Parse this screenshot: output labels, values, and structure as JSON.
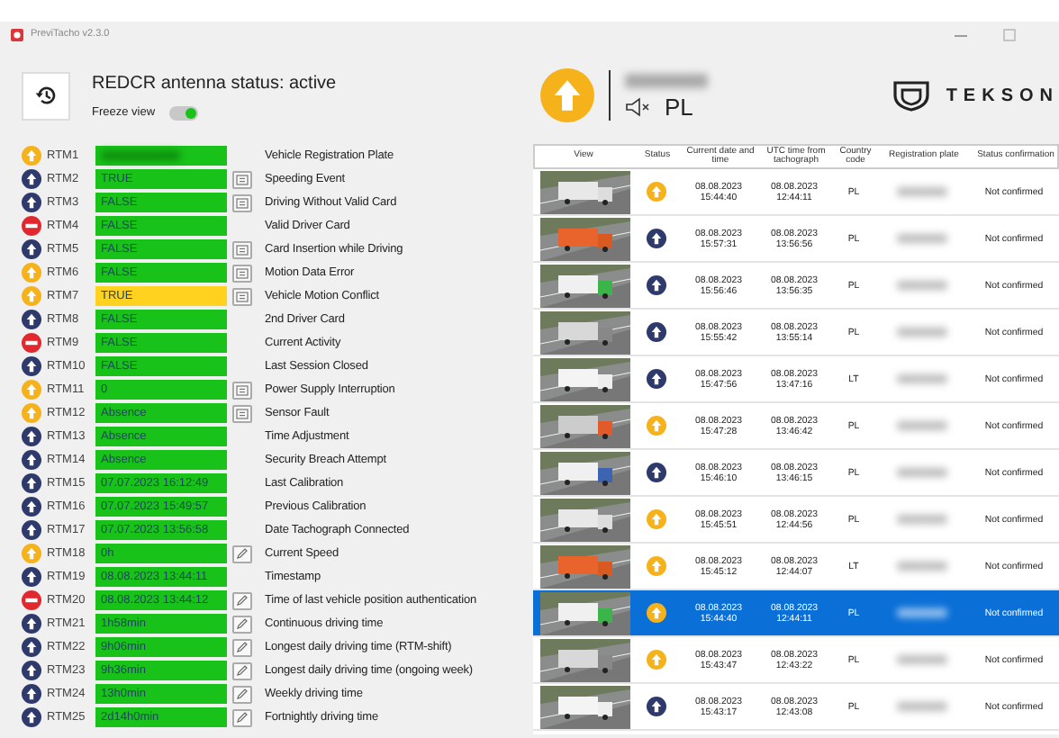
{
  "window": {
    "title": "PreviTacho v2.3.0"
  },
  "antenna": {
    "status_text": "REDCR antenna status: active",
    "freeze_view": {
      "label": "Freeze view",
      "on": true
    }
  },
  "vehicle": {
    "alert": {
      "kind": "warning"
    },
    "sound_muted": true,
    "country": "PL"
  },
  "logo": {
    "text": "TEKSON"
  },
  "rtm": [
    {
      "id": "RTM1",
      "status": {
        "kind": "warning"
      },
      "color": "#19c219",
      "label": "Vehicle Registration Plate"
    },
    {
      "id": "RTM2",
      "status": {
        "kind": "info"
      },
      "value": "TRUE",
      "color": "#19c219",
      "button": {
        "kind": "details"
      },
      "label": "Speeding Event"
    },
    {
      "id": "RTM3",
      "status": {
        "kind": "info"
      },
      "value": "FALSE",
      "color": "#19c219",
      "button": {
        "kind": "details"
      },
      "label": "Driving Without Valid Card"
    },
    {
      "id": "RTM4",
      "status": {
        "kind": "error"
      },
      "value": "FALSE",
      "color": "#19c219",
      "label": "Valid Driver Card"
    },
    {
      "id": "RTM5",
      "status": {
        "kind": "info"
      },
      "value": "FALSE",
      "color": "#19c219",
      "button": {
        "kind": "details"
      },
      "label": "Card Insertion while Driving"
    },
    {
      "id": "RTM6",
      "status": {
        "kind": "warning"
      },
      "value": "FALSE",
      "color": "#19c219",
      "button": {
        "kind": "details"
      },
      "label": "Motion Data Error"
    },
    {
      "id": "RTM7",
      "status": {
        "kind": "warning"
      },
      "value": "TRUE",
      "color": "#ffd21f",
      "button": {
        "kind": "details"
      },
      "label": "Vehicle Motion Conflict"
    },
    {
      "id": "RTM8",
      "status": {
        "kind": "info"
      },
      "value": "FALSE",
      "color": "#19c219",
      "label": "2nd Driver Card"
    },
    {
      "id": "RTM9",
      "status": {
        "kind": "error"
      },
      "value": "FALSE",
      "color": "#19c219",
      "label": "Current Activity"
    },
    {
      "id": "RTM10",
      "status": {
        "kind": "info"
      },
      "value": "FALSE",
      "color": "#19c219",
      "label": "Last Session Closed"
    },
    {
      "id": "RTM11",
      "status": {
        "kind": "warning"
      },
      "value": "0",
      "color": "#19c219",
      "button": {
        "kind": "details"
      },
      "label": "Power Supply Interruption"
    },
    {
      "id": "RTM12",
      "status": {
        "kind": "warning"
      },
      "value": "Absence",
      "color": "#19c219",
      "button": {
        "kind": "details"
      },
      "label": "Sensor Fault"
    },
    {
      "id": "RTM13",
      "status": {
        "kind": "info"
      },
      "value": "Absence",
      "color": "#19c219",
      "label": "Time Adjustment"
    },
    {
      "id": "RTM14",
      "status": {
        "kind": "info"
      },
      "value": "Absence",
      "color": "#19c219",
      "label": "Security Breach Attempt"
    },
    {
      "id": "RTM15",
      "status": {
        "kind": "info"
      },
      "value": "07.07.2023 16:12:49",
      "color": "#19c219",
      "label": "Last Calibration"
    },
    {
      "id": "RTM16",
      "status": {
        "kind": "info"
      },
      "value": "07.07.2023 15:49:57",
      "color": "#19c219",
      "label": "Previous Calibration"
    },
    {
      "id": "RTM17",
      "status": {
        "kind": "info"
      },
      "value": "07.07.2023 13:56:58",
      "color": "#19c219",
      "label": "Date Tachograph Connected"
    },
    {
      "id": "RTM18",
      "status": {
        "kind": "warning"
      },
      "value": "0h",
      "color": "#19c219",
      "button": {
        "kind": "edit"
      },
      "label": "Current Speed"
    },
    {
      "id": "RTM19",
      "status": {
        "kind": "info"
      },
      "value": "08.08.2023 13:44:11",
      "color": "#19c219",
      "label": "Timestamp"
    },
    {
      "id": "RTM20",
      "status": {
        "kind": "error"
      },
      "value": "08.08.2023 13:44:12",
      "color": "#19c219",
      "button": {
        "kind": "edit"
      },
      "label": "Time of last vehicle position authentication"
    },
    {
      "id": "RTM21",
      "status": {
        "kind": "info"
      },
      "value": "1h58min",
      "color": "#19c219",
      "button": {
        "kind": "edit"
      },
      "label": "Continuous driving time"
    },
    {
      "id": "RTM22",
      "status": {
        "kind": "info"
      },
      "value": "9h06min",
      "color": "#19c219",
      "button": {
        "kind": "edit"
      },
      "label": "Longest daily driving time (RTM-shift)"
    },
    {
      "id": "RTM23",
      "status": {
        "kind": "info"
      },
      "value": "9h36min",
      "color": "#19c219",
      "button": {
        "kind": "edit"
      },
      "label": "Longest daily driving time (ongoing week)"
    },
    {
      "id": "RTM24",
      "status": {
        "kind": "info"
      },
      "value": "13h0min",
      "color": "#19c219",
      "button": {
        "kind": "edit"
      },
      "label": "Weekly driving time"
    },
    {
      "id": "RTM25",
      "status": {
        "kind": "info"
      },
      "value": "2d14h0min",
      "color": "#19c219",
      "button": {
        "kind": "edit"
      },
      "label": "Fortnightly driving time"
    }
  ],
  "table": {
    "columns": [
      "View",
      "Status",
      "Current date and time",
      "UTC time from tachograph",
      "Country code",
      "Registration plate",
      "Status confirmation"
    ],
    "rows": [
      {
        "status": {
          "kind": "warning"
        },
        "date": "08.08.2023",
        "time": "15:44:40",
        "utc_date": "08.08.2023",
        "utc_time": "12:44:11",
        "country": "PL",
        "confirmation": "Not confirmed",
        "selected": false
      },
      {
        "status": {
          "kind": "info"
        },
        "date": "08.08.2023",
        "time": "15:57:31",
        "utc_date": "08.08.2023",
        "utc_time": "13:56:56",
        "country": "PL",
        "confirmation": "Not confirmed",
        "selected": false
      },
      {
        "status": {
          "kind": "info"
        },
        "date": "08.08.2023",
        "time": "15:56:46",
        "utc_date": "08.08.2023",
        "utc_time": "13:56:35",
        "country": "PL",
        "confirmation": "Not confirmed",
        "selected": false
      },
      {
        "status": {
          "kind": "info"
        },
        "date": "08.08.2023",
        "time": "15:55:42",
        "utc_date": "08.08.2023",
        "utc_time": "13:55:14",
        "country": "PL",
        "confirmation": "Not confirmed",
        "selected": false
      },
      {
        "status": {
          "kind": "info"
        },
        "date": "08.08.2023",
        "time": "15:47:56",
        "utc_date": "08.08.2023",
        "utc_time": "13:47:16",
        "country": "LT",
        "confirmation": "Not confirmed",
        "selected": false
      },
      {
        "status": {
          "kind": "warning"
        },
        "date": "08.08.2023",
        "time": "15:47:28",
        "utc_date": "08.08.2023",
        "utc_time": "13:46:42",
        "country": "PL",
        "confirmation": "Not confirmed",
        "selected": false
      },
      {
        "status": {
          "kind": "info"
        },
        "date": "08.08.2023",
        "time": "15:46:10",
        "utc_date": "08.08.2023",
        "utc_time": "13:46:15",
        "country": "PL",
        "confirmation": "Not confirmed",
        "selected": false
      },
      {
        "status": {
          "kind": "warning"
        },
        "date": "08.08.2023",
        "time": "15:45:51",
        "utc_date": "08.08.2023",
        "utc_time": "12:44:56",
        "country": "PL",
        "confirmation": "Not confirmed",
        "selected": false
      },
      {
        "status": {
          "kind": "warning"
        },
        "date": "08.08.2023",
        "time": "15:45:12",
        "utc_date": "08.08.2023",
        "utc_time": "12:44:07",
        "country": "LT",
        "confirmation": "Not confirmed",
        "selected": false
      },
      {
        "status": {
          "kind": "warning"
        },
        "date": "08.08.2023",
        "time": "15:44:40",
        "utc_date": "08.08.2023",
        "utc_time": "12:44:11",
        "country": "PL",
        "confirmation": "Not confirmed",
        "selected": true
      },
      {
        "status": {
          "kind": "warning"
        },
        "date": "08.08.2023",
        "time": "15:43:47",
        "utc_date": "08.08.2023",
        "utc_time": "12:43:22",
        "country": "PL",
        "confirmation": "Not confirmed",
        "selected": false
      },
      {
        "status": {
          "kind": "info"
        },
        "date": "08.08.2023",
        "time": "15:43:17",
        "utc_date": "08.08.2023",
        "utc_time": "12:43:08",
        "country": "PL",
        "confirmation": "Not confirmed",
        "selected": false
      }
    ]
  }
}
